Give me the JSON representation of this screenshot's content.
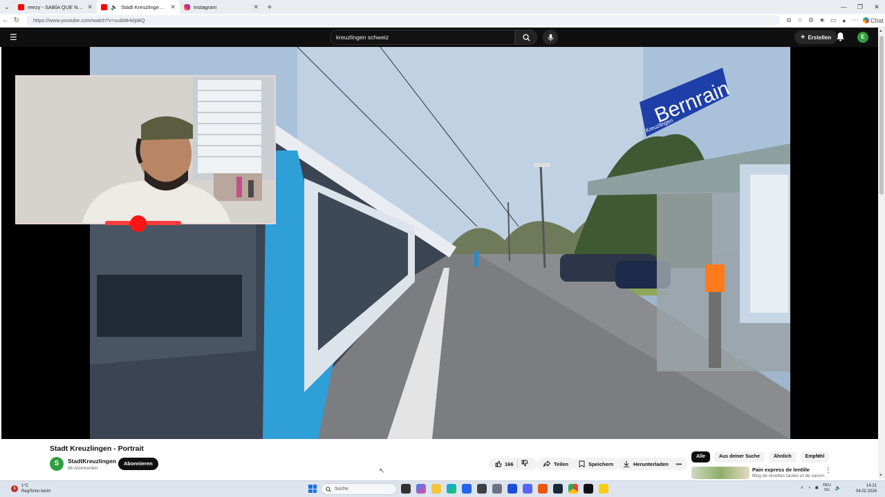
{
  "browser": {
    "tabs": [
      {
        "title": "reezy - SABÍA QUE NO (Official Vi",
        "favicon": "youtube-favicon",
        "active": false
      },
      {
        "title": "Stadt Kreuzlingen - Portrait -",
        "favicon": "youtube-favicon",
        "active": true
      },
      {
        "title": "Instagram",
        "favicon": "instagram-favicon",
        "active": false
      }
    ],
    "url": "https://www.youtube.com/watch?v=uuib9HxlpBQ",
    "chat_label": "Chat"
  },
  "masthead": {
    "search_value": "kreuzlingen schweiz",
    "create_label": "Erstellen",
    "avatar_letter": "E"
  },
  "video": {
    "station_sign": "Bernrain",
    "station_sign_sub": "Kreuzlingen",
    "title": "Stadt Kreuzlingen - Portrait",
    "channel": {
      "name": "StadtKreuzlingen",
      "subscribers": "86 Abonnenten",
      "avatar_letter": "S"
    },
    "subscribe_label": "Abonnieren",
    "likes": "166",
    "share_label": "Teilen",
    "save_label": "Speichern",
    "download_label": "Herunterladen"
  },
  "recommendations": {
    "chips": [
      "Alle",
      "Aus deiner Suche",
      "Ähnlich",
      "Empfehl"
    ],
    "first": {
      "title": "Pain express de lentille",
      "subtitle": "Blog de recettes faciles et de saison"
    }
  },
  "taskbar": {
    "weather_temp": "1°C",
    "weather_desc": "Reg/Schn leicht",
    "weather_badge": "1",
    "search_placeholder": "Suche",
    "lang_top": "DEU",
    "lang_bottom": "SG",
    "time": "14:21",
    "date": "04.02.2026"
  },
  "colors": {
    "youtube_red": "#ff0000",
    "dark_bg": "#0f0f0f",
    "channel_green": "#2e9e3f"
  }
}
